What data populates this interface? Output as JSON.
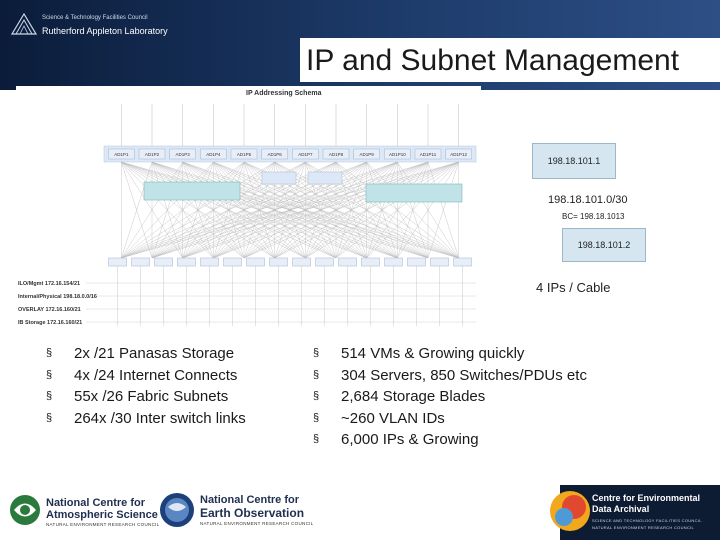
{
  "header": {
    "org_line1": "Science & Technology Facilities Council",
    "org_line2": "Rutherford Appleton Laboratory",
    "title": "IP and Subnet Management"
  },
  "diagram": {
    "title": "IP Addressing Schema",
    "switch_labels": [
      "AD1P1",
      "AD1P2",
      "AD1P3",
      "AD1P4",
      "AD1P5",
      "AD1P6",
      "AD1P7",
      "AD1P8",
      "AD1P9",
      "AD1P10",
      "AD1P11",
      "AD1P12"
    ],
    "network_labels": [
      "ILO/Mgmt 172.16.154/21",
      "Internal/Physical 198.18.0.0/16",
      "OVERLAY 172.16.160/21",
      "IB Storage 172.16.160/21"
    ]
  },
  "callouts": {
    "ip1": "198.18.101.1",
    "subnet": "198.18.101.0/30",
    "bc": "BC= 198.18.1013",
    "ip2": "198.18.101.2",
    "cable": "4 IPs / Cable"
  },
  "bullets_left": [
    "2x /21 Panasas Storage",
    "4x /24 Internet Connects",
    "55x /26 Fabric Subnets",
    "264x /30 Inter switch links"
  ],
  "bullets_right": [
    "514 VMs & Growing quickly",
    "304 Servers, 850 Switches/PDUs etc",
    "2,684 Storage Blades",
    "~260 VLAN IDs",
    "6,000 IPs & Growing"
  ],
  "bullet_glyph": "§",
  "footer": {
    "ncas_line1": "National Centre for",
    "ncas_line2": "Atmospheric Science",
    "ncas_sub": "NATURAL ENVIRONMENT RESEARCH COUNCIL",
    "nceo_line1": "National Centre for",
    "nceo_line2": "Earth Observation",
    "nceo_sub": "NATURAL ENVIRONMENT RESEARCH COUNCIL",
    "ceda_line1": "Centre for Environmental",
    "ceda_line2": "Data Archival",
    "ceda_sub1": "SCIENCE AND TECHNOLOGY FACILITIES COUNCIL",
    "ceda_sub2": "NATURAL ENVIRONMENT RESEARCH COUNCIL"
  },
  "colors": {
    "header_navy": "#0b1c3a",
    "diagram_box": "#bfe3e6",
    "node_box": "#dde8f6",
    "callout_fill": "#d6e6f0"
  }
}
